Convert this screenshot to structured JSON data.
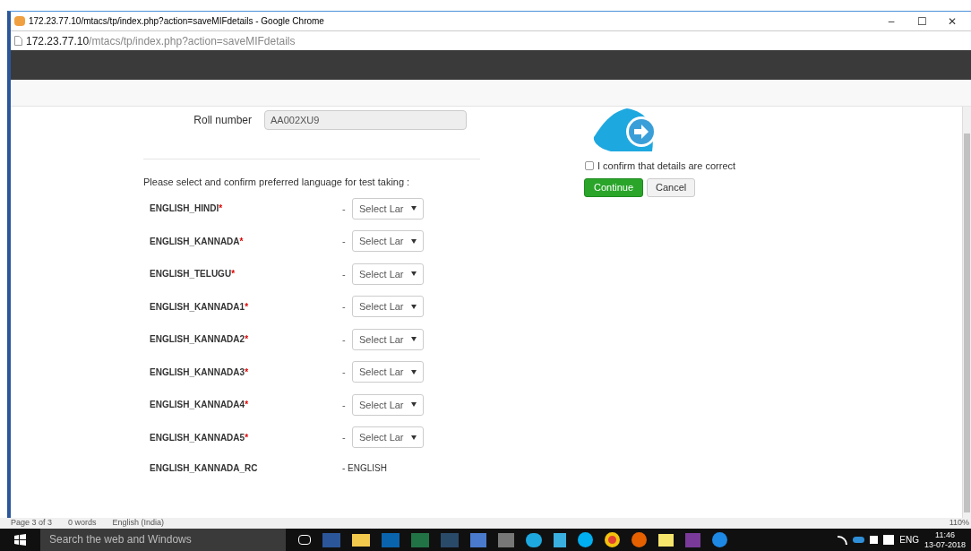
{
  "window": {
    "title": "172.23.77.10/mtacs/tp/index.php?action=saveMIFdetails - Google Chrome",
    "controls": [
      "–",
      "☐",
      "✕"
    ]
  },
  "address_bar": {
    "host": "172.23.77.10",
    "path": "/mtacs/tp/index.php?action=saveMIFdetails"
  },
  "form": {
    "roll_label": "Roll number",
    "roll_value": "AA002XU9",
    "language_prompt": "Please select and confirm preferred language for test taking :",
    "rows": [
      {
        "kind": "select",
        "label": "ENGLISH_HINDI",
        "marker": "*",
        "dash": "-",
        "value": "Select Lar"
      },
      {
        "kind": "select",
        "label": "ENGLISH_KANNADA",
        "marker": "*",
        "dash": "-",
        "value": "Select Lar"
      },
      {
        "kind": "select",
        "label": "ENGLISH_TELUGU",
        "marker": "*",
        "dash": "-",
        "value": "Select Lar"
      },
      {
        "kind": "select",
        "label": "ENGLISH_KANNADA1",
        "marker": "*",
        "dash": "-",
        "value": "Select Lar"
      },
      {
        "kind": "select",
        "label": "ENGLISH_KANNADA2",
        "marker": "*",
        "dash": "-",
        "value": "Select Lar"
      },
      {
        "kind": "select",
        "label": "ENGLISH_KANNADA3",
        "marker": "*",
        "dash": "-",
        "value": "Select Lar"
      },
      {
        "kind": "select",
        "label": "ENGLISH_KANNADA4",
        "marker": "*",
        "dash": "-",
        "value": "Select Lar"
      },
      {
        "kind": "select",
        "label": "ENGLISH_KANNADA5",
        "marker": "*",
        "dash": "-",
        "value": "Select Lar"
      },
      {
        "kind": "text",
        "label": "ENGLISH_KANNADA_RC",
        "value": "- ENGLISH"
      }
    ]
  },
  "confirm": {
    "label": "I confirm that details are correct",
    "checked": false
  },
  "buttons": [
    {
      "kind": "primary",
      "label": "Continue"
    },
    {
      "kind": "default",
      "label": "Cancel"
    }
  ],
  "word_status": [
    "Page 3 of 3",
    "0 words",
    "English (India)"
  ],
  "word_zoom": "110%",
  "taskbar": {
    "search_placeholder": "Search the web and Windows",
    "tray_language": "ENG",
    "time": "11:46",
    "date": "13-07-2018"
  }
}
